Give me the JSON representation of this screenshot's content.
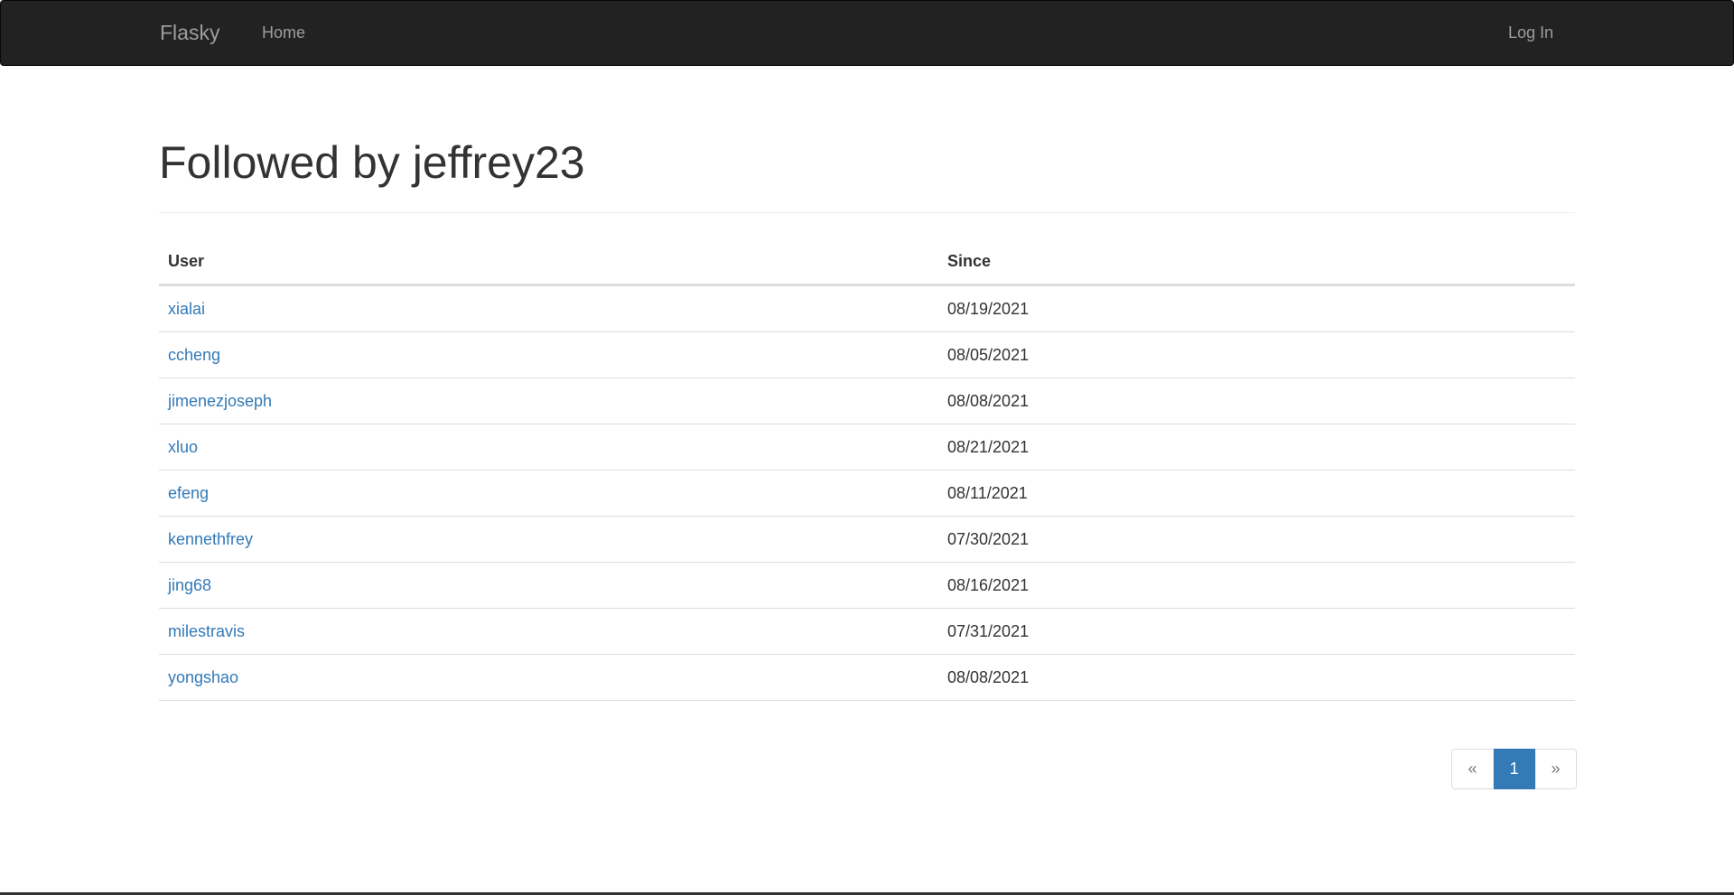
{
  "navbar": {
    "brand": "Flasky",
    "home_label": "Home",
    "login_label": "Log In",
    "background_color": "#222222",
    "link_color": "#9d9d9d"
  },
  "page": {
    "title": "Followed by jeffrey23"
  },
  "table": {
    "headers": {
      "user": "User",
      "since": "Since"
    },
    "rows": [
      {
        "user": "xialai",
        "since": "08/19/2021"
      },
      {
        "user": "ccheng",
        "since": "08/05/2021"
      },
      {
        "user": "jimenezjoseph",
        "since": "08/08/2021"
      },
      {
        "user": "xluo",
        "since": "08/21/2021"
      },
      {
        "user": "efeng",
        "since": "08/11/2021"
      },
      {
        "user": "kennethfrey",
        "since": "07/30/2021"
      },
      {
        "user": "jing68",
        "since": "08/16/2021"
      },
      {
        "user": "milestravis",
        "since": "07/31/2021"
      },
      {
        "user": "yongshao",
        "since": "08/08/2021"
      }
    ]
  },
  "pagination": {
    "prev": "«",
    "current": "1",
    "next": "»",
    "active_color": "#337ab7"
  },
  "link_color": "#337ab7"
}
